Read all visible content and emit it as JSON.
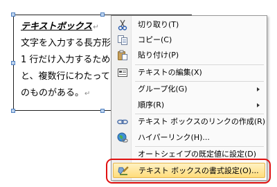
{
  "document": {
    "textbox_lines": [
      "テキストボックス",
      "文字を入力する長方形",
      "1 行だけ入力するため",
      "と、複数行にわたって",
      "のものがある。"
    ],
    "return_mark": "↵"
  },
  "context_menu": {
    "items": [
      {
        "label": "切り取り(T)",
        "icon": "scissors-icon"
      },
      {
        "label": "コピー(C)",
        "icon": "copy-icon"
      },
      {
        "label": "貼り付け(P)",
        "icon": "paste-icon"
      },
      {
        "label": "テキストの編集(X)",
        "icon": "edit-text-icon"
      },
      {
        "label": "グループ化(G)",
        "icon": "",
        "submenu": true
      },
      {
        "label": "順序(R)",
        "icon": "",
        "submenu": true
      },
      {
        "label": "テキスト ボックスのリンクの作成(R)",
        "icon": "chain-link-icon"
      },
      {
        "label": "ハイパーリンク(H)...",
        "icon": "hyperlink-globe-icon"
      },
      {
        "label": "オートシェイプの既定値に設定(D)",
        "icon": ""
      },
      {
        "label": "テキスト ボックスの書式設定(O)...",
        "icon": "format-textbox-icon",
        "highlighted": true
      }
    ]
  },
  "colors": {
    "highlight_border": "#e5b54d",
    "annotation_frame": "#e01010"
  }
}
